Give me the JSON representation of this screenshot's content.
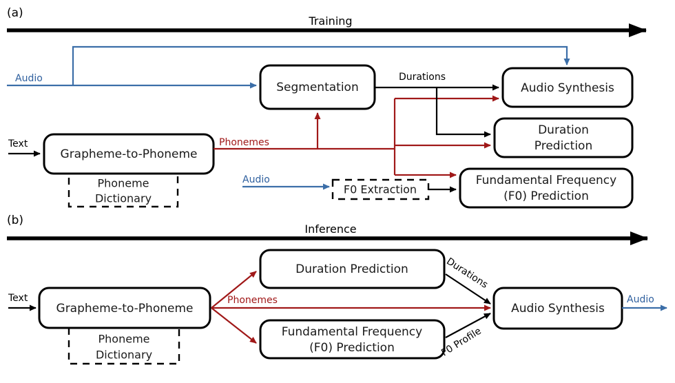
{
  "figure": {
    "panels": [
      {
        "id": "a",
        "label": "(a)",
        "phase_title": "Training",
        "nodes": [
          {
            "id": "g2p_a",
            "label": "Grapheme-to-Phoneme",
            "style": "solid"
          },
          {
            "id": "dict_a",
            "label_line1": "Phoneme",
            "label_line2": "Dictionary",
            "style": "dashed"
          },
          {
            "id": "seg_a",
            "label": "Segmentation",
            "style": "solid"
          },
          {
            "id": "f0ext_a",
            "label": "F0 Extraction",
            "style": "dashed"
          },
          {
            "id": "audsyn_a",
            "label": "Audio Synthesis",
            "style": "solid"
          },
          {
            "id": "durpred_a",
            "label_line1": "Duration",
            "label_line2": "Prediction",
            "style": "solid"
          },
          {
            "id": "f0pred_a",
            "label_line1": "Fundamental Frequency",
            "label_line2": "(F0) Prediction",
            "style": "solid"
          }
        ],
        "edge_labels": [
          {
            "id": "text_in_a",
            "text": "Text",
            "color": "#000000"
          },
          {
            "id": "audio_in_a",
            "text": "Audio",
            "color": "#3B6EA8"
          },
          {
            "id": "audio_f0_a",
            "text": "Audio",
            "color": "#3B6EA8"
          },
          {
            "id": "phonemes_a",
            "text": "Phonemes",
            "color": "#A01818"
          },
          {
            "id": "durations_a",
            "text": "Durations",
            "color": "#000000"
          }
        ]
      },
      {
        "id": "b",
        "label": "(b)",
        "phase_title": "Inference",
        "nodes": [
          {
            "id": "g2p_b",
            "label": "Grapheme-to-Phoneme",
            "style": "solid"
          },
          {
            "id": "dict_b",
            "label_line1": "Phoneme",
            "label_line2": "Dictionary",
            "style": "dashed"
          },
          {
            "id": "durpred_b",
            "label": "Duration Prediction",
            "style": "solid"
          },
          {
            "id": "f0pred_b",
            "label_line1": "Fundamental Frequency",
            "label_line2": "(F0) Prediction",
            "style": "solid"
          },
          {
            "id": "audsyn_b",
            "label": "Audio Synthesis",
            "style": "solid"
          }
        ],
        "edge_labels": [
          {
            "id": "text_in_b",
            "text": "Text",
            "color": "#000000"
          },
          {
            "id": "phonemes_b",
            "text": "Phonemes",
            "color": "#A01818"
          },
          {
            "id": "durations_b",
            "text": "Durations",
            "color": "#000000"
          },
          {
            "id": "f0profile_b",
            "text": "F0 Profile",
            "color": "#000000"
          },
          {
            "id": "audio_out_b",
            "text": "Audio",
            "color": "#3B6EA8"
          }
        ]
      }
    ],
    "colors": {
      "black": "#000000",
      "red": "#A01818",
      "blue": "#3B6EA8",
      "background": "#ffffff"
    }
  }
}
